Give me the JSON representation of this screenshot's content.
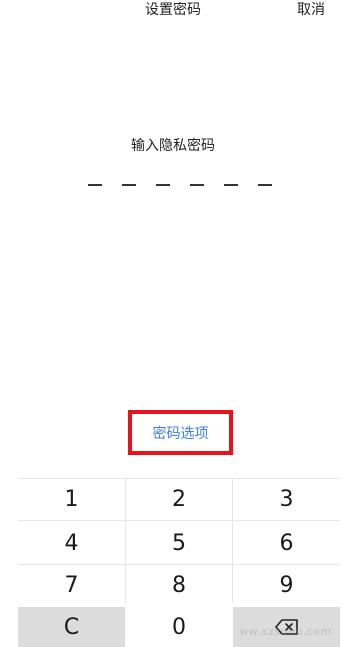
{
  "header": {
    "title": "设置密码",
    "cancel_label": "取消"
  },
  "prompt": {
    "text": "输入隐私密码"
  },
  "pin": {
    "length": 6,
    "entered": 0
  },
  "options": {
    "label": "密码选项"
  },
  "keypad": {
    "keys": [
      "1",
      "2",
      "3",
      "4",
      "5",
      "6",
      "7",
      "8",
      "9",
      "C",
      "0",
      "backspace-icon"
    ]
  },
  "watermark": {
    "text": "ww.xzsuhu.com"
  },
  "colors": {
    "accent": "#3d7ef0",
    "highlight_border": "#e8141b",
    "key_gray": "#dcdcdc",
    "divider": "#e6e6e6"
  }
}
